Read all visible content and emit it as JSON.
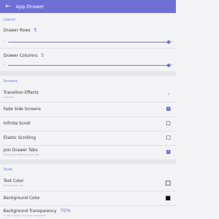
{
  "appbar": {
    "title": "App Drawer",
    "back_icon": "arrow-left-icon"
  },
  "layout": {
    "header": "Layout",
    "drawer_rows": {
      "label": "Drawer Rows",
      "value": "5",
      "min": "2",
      "max": "8",
      "fraction": 1.0
    },
    "drawer_columns": {
      "label": "Drawer Columns",
      "value": "5",
      "min": "2",
      "max": "8",
      "fraction": 1.0
    }
  },
  "screens": {
    "header": "Screens",
    "transition_effects": {
      "label": "Transition Effects",
      "subtitle": "Card stack"
    },
    "fade_side_screens": {
      "label": "Fade Side Screens",
      "checked": true
    },
    "infinite_scroll": {
      "label": "Infinite Scroll",
      "checked": false
    },
    "elastic_scrolling": {
      "label": "Elastic Scrolling",
      "checked": false
    },
    "join_drawer_tabs": {
      "label": "Join Drawer Tabs",
      "subtitle": "Swipe across different drawer tabs",
      "checked": true
    }
  },
  "style": {
    "header": "Style",
    "text_color": {
      "label": "Text Color",
      "subtitle": "Use label text color",
      "color": "#ffffff"
    },
    "background_color": {
      "label": "Background Color",
      "color": "#000000"
    },
    "background_transparency": {
      "label": "Background Transparency",
      "value": "70%",
      "subtitle": "0 means opaque; 100 means transparent"
    }
  },
  "colors": {
    "accent": "#6f6fd6"
  }
}
